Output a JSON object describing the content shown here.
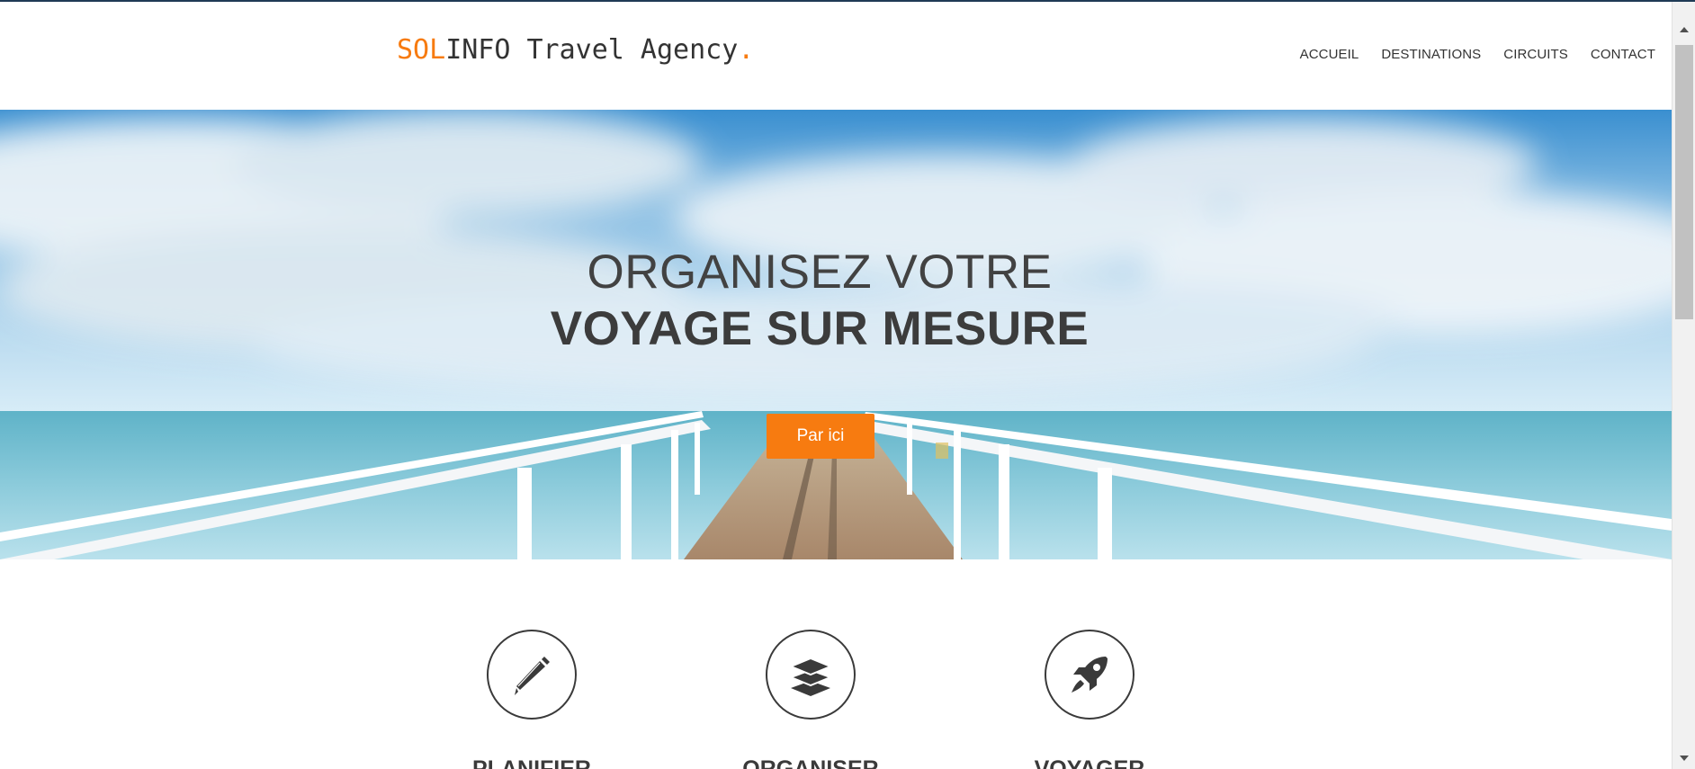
{
  "brand": {
    "logo_part1": "SOL",
    "logo_part2": "INFO Travel Agency",
    "logo_dot": ".",
    "accent_color": "#f77b10"
  },
  "nav": {
    "items": [
      {
        "label": "ACCUEIL"
      },
      {
        "label": "DESTINATIONS"
      },
      {
        "label": "CIRCUITS"
      },
      {
        "label": "CONTACT"
      }
    ]
  },
  "hero": {
    "title_line1": "ORGANISEZ VOTRE",
    "title_line2": "VOYAGE SUR MESURE",
    "cta_label": "Par ici"
  },
  "features": [
    {
      "title": "PLANIFIER",
      "icon": "pencil-icon"
    },
    {
      "title": "ORGANISER",
      "icon": "layers-icon"
    },
    {
      "title": "VOYAGER",
      "icon": "rocket-icon"
    }
  ]
}
